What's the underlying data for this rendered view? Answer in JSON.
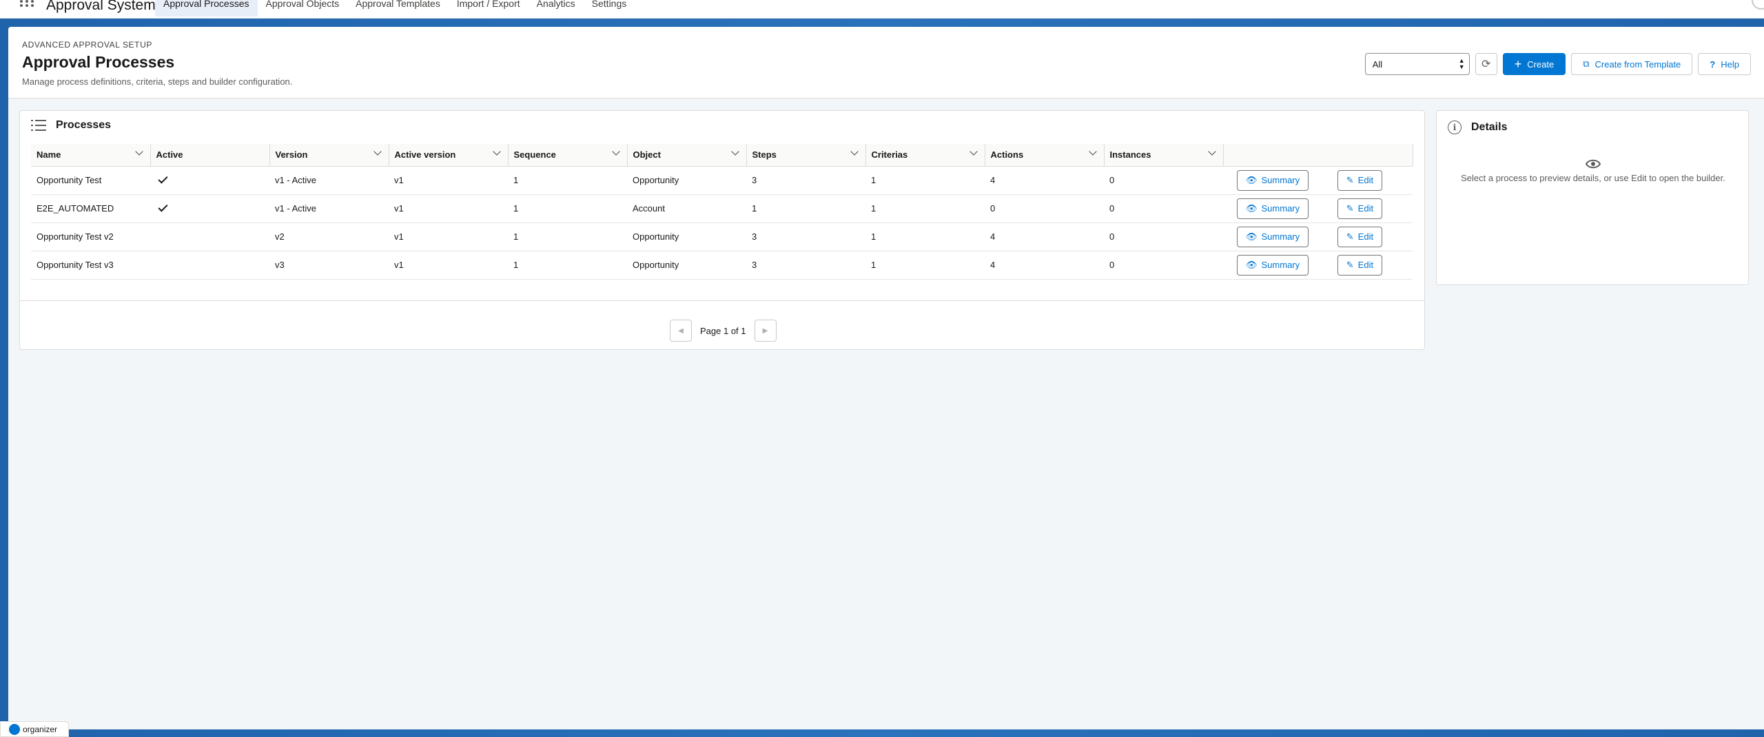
{
  "app": {
    "name": "Approval System"
  },
  "nav": {
    "tabs": [
      {
        "label": "Approval Processes",
        "active": true
      },
      {
        "label": "Approval Objects"
      },
      {
        "label": "Approval Templates"
      },
      {
        "label": "Import / Export"
      },
      {
        "label": "Analytics"
      },
      {
        "label": "Settings"
      }
    ]
  },
  "header": {
    "eyebrow": "ADVANCED APPROVAL SETUP",
    "title": "Approval Processes",
    "description": "Manage process definitions, criteria, steps and builder configuration.",
    "filter_value": "All",
    "create_label": "Create",
    "create_from_template_label": "Create from Template",
    "help_label": "Help"
  },
  "processes": {
    "title": "Processes",
    "columns": [
      "Name",
      "Active",
      "Version",
      "Active version",
      "Sequence",
      "Object",
      "Steps",
      "Criterias",
      "Actions",
      "Instances"
    ],
    "rows": [
      {
        "name": "Opportunity Test",
        "active": true,
        "version": "v1 - Active",
        "active_version": "v1",
        "sequence": "1",
        "object": "Opportunity",
        "steps": "3",
        "criterias": "1",
        "actions": "4",
        "instances": "0"
      },
      {
        "name": "E2E_AUTOMATED",
        "active": true,
        "version": "v1 - Active",
        "active_version": "v1",
        "sequence": "1",
        "object": "Account",
        "steps": "1",
        "criterias": "1",
        "actions": "0",
        "instances": "0"
      },
      {
        "name": "Opportunity Test v2",
        "active": false,
        "version": "v2",
        "active_version": "v1",
        "sequence": "1",
        "object": "Opportunity",
        "steps": "3",
        "criterias": "1",
        "actions": "4",
        "instances": "0"
      },
      {
        "name": "Opportunity Test v3",
        "active": false,
        "version": "v3",
        "active_version": "v1",
        "sequence": "1",
        "object": "Opportunity",
        "steps": "3",
        "criterias": "1",
        "actions": "4",
        "instances": "0"
      }
    ],
    "summary_label": "Summary",
    "edit_label": "Edit",
    "pager_text": "Page 1 of 1"
  },
  "details": {
    "title": "Details",
    "empty_text": "Select a process to preview details, or use Edit to open the builder."
  },
  "footer": {
    "organizer_label": "organizer"
  },
  "colors": {
    "brand": "#0176d3",
    "band": "#1f63ab"
  }
}
